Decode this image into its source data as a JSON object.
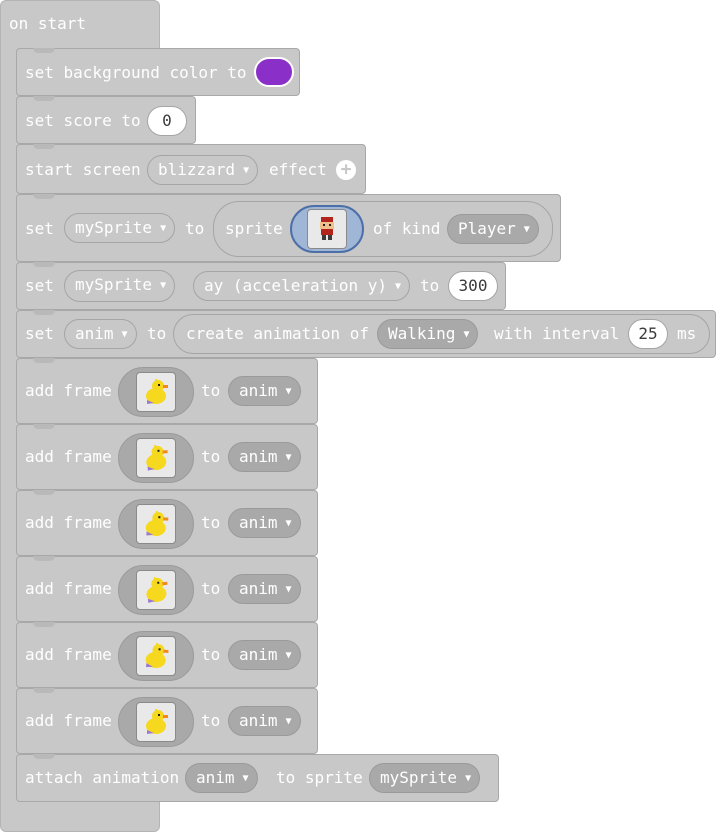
{
  "on_start": {
    "label": "on start"
  },
  "colors": {
    "block": "#c8c8c8",
    "background_swatch": "#8b2fc9"
  },
  "rows": {
    "bg": {
      "text": "set background color to"
    },
    "score": {
      "text": "set score to",
      "value": "0"
    },
    "screen": {
      "text1": "start screen",
      "effect": "blizzard",
      "text2": "effect"
    },
    "sprite": {
      "set": "set",
      "var": "mySprite",
      "to": "to",
      "sprite": "sprite",
      "of_kind": "of kind",
      "kind": "Player"
    },
    "ay": {
      "set": "set",
      "var": "mySprite",
      "prop": "ay (acceleration y)",
      "to": "to",
      "value": "300"
    },
    "anim": {
      "set": "set",
      "var": "anim",
      "to": "to",
      "create": "create animation of",
      "action": "Walking",
      "with_interval": "with interval",
      "interval": "25",
      "ms": "ms"
    },
    "add_frame": {
      "label": "add frame",
      "to": "to",
      "var": "anim"
    },
    "attach": {
      "label": "attach animation",
      "anim": "anim",
      "to_sprite": "to sprite",
      "sprite": "mySprite"
    }
  }
}
